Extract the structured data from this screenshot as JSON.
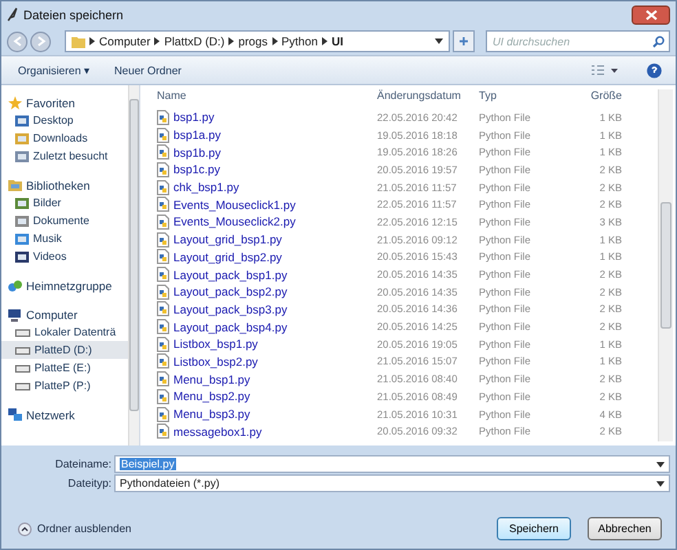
{
  "window": {
    "title": "Dateien speichern"
  },
  "address": {
    "crumbs": [
      "Computer",
      "PlattxD (D:)",
      "progs",
      "Python",
      "UI"
    ]
  },
  "search": {
    "placeholder": "UI durchsuchen"
  },
  "toolbar": {
    "organize": "Organisieren ▾",
    "new_folder": "Neuer Ordner"
  },
  "sidebar": {
    "groups": [
      {
        "label": "Favoriten",
        "children": [
          {
            "label": "Desktop",
            "selected": false
          },
          {
            "label": "Downloads",
            "selected": false
          },
          {
            "label": "Zuletzt besucht",
            "selected": false
          }
        ]
      },
      {
        "label": "Bibliotheken",
        "children": [
          {
            "label": "Bilder",
            "selected": false
          },
          {
            "label": "Dokumente",
            "selected": false
          },
          {
            "label": "Musik",
            "selected": false
          },
          {
            "label": "Videos",
            "selected": false
          }
        ]
      },
      {
        "label": "Heimnetzgruppe"
      },
      {
        "label": "Computer",
        "children": [
          {
            "label": "Lokaler Datenträ",
            "selected": false
          },
          {
            "label": "PlatteD (D:)",
            "selected": true
          },
          {
            "label": "PlatteE (E:)",
            "selected": false
          },
          {
            "label": "PlatteP (P:)",
            "selected": false
          }
        ]
      },
      {
        "label": "Netzwerk"
      }
    ]
  },
  "table": {
    "columns": [
      "Name",
      "Änderungsdatum",
      "Typ",
      "Größe"
    ],
    "rows": [
      [
        "bsp1.py",
        "22.05.2016 20:42",
        "Python File",
        "1 KB"
      ],
      [
        "bsp1a.py",
        "19.05.2016 18:18",
        "Python File",
        "1 KB"
      ],
      [
        "bsp1b.py",
        "19.05.2016 18:26",
        "Python File",
        "1 KB"
      ],
      [
        "bsp1c.py",
        "20.05.2016 19:57",
        "Python File",
        "2 KB"
      ],
      [
        "chk_bsp1.py",
        "21.05.2016 11:57",
        "Python File",
        "2 KB"
      ],
      [
        "Events_Mouseclick1.py",
        "22.05.2016 11:57",
        "Python File",
        "2 KB"
      ],
      [
        "Events_Mouseclick2.py",
        "22.05.2016 12:15",
        "Python File",
        "3 KB"
      ],
      [
        "Layout_grid_bsp1.py",
        "21.05.2016 09:12",
        "Python File",
        "1 KB"
      ],
      [
        "Layout_grid_bsp2.py",
        "20.05.2016 15:43",
        "Python File",
        "1 KB"
      ],
      [
        "Layout_pack_bsp1.py",
        "20.05.2016 14:35",
        "Python File",
        "2 KB"
      ],
      [
        "Layout_pack_bsp2.py",
        "20.05.2016 14:35",
        "Python File",
        "2 KB"
      ],
      [
        "Layout_pack_bsp3.py",
        "20.05.2016 14:36",
        "Python File",
        "2 KB"
      ],
      [
        "Layout_pack_bsp4.py",
        "20.05.2016 14:25",
        "Python File",
        "2 KB"
      ],
      [
        "Listbox_bsp1.py",
        "20.05.2016 19:05",
        "Python File",
        "1 KB"
      ],
      [
        "Listbox_bsp2.py",
        "21.05.2016 15:07",
        "Python File",
        "1 KB"
      ],
      [
        "Menu_bsp1.py",
        "21.05.2016 08:40",
        "Python File",
        "2 KB"
      ],
      [
        "Menu_bsp2.py",
        "21.05.2016 08:49",
        "Python File",
        "2 KB"
      ],
      [
        "Menu_bsp3.py",
        "21.05.2016 10:31",
        "Python File",
        "4 KB"
      ],
      [
        "messagebox1.py",
        "20.05.2016 09:32",
        "Python File",
        "2 KB"
      ]
    ]
  },
  "filename": {
    "label": "Dateiname:",
    "value": "Beispiel.py"
  },
  "filetype": {
    "label": "Dateityp:",
    "value": "Pythondateien (*.py)"
  },
  "hide_folders": "Ordner ausblenden",
  "buttons": {
    "save": "Speichern",
    "cancel": "Abbrechen"
  }
}
